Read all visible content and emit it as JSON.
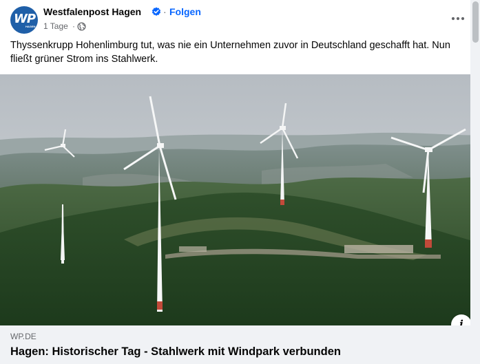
{
  "post": {
    "page_name": "Westfalenpost Hagen",
    "separator": "·",
    "follow_label": "Folgen",
    "time": "1 Tage",
    "meta_separator": "·",
    "text": "Thyssenkrupp Hohenlimburg tut, was nie ein Unternehmen zuvor in Deutschland geschafft hat. Nun fließt grüner Strom ins Stahlwerk.",
    "avatar_logo": "WP",
    "avatar_logo_sub": "HAGEN"
  },
  "link_card": {
    "domain": "WP.DE",
    "title": "Hagen: Historischer Tag - Stahlwerk mit Windpark verbunden"
  },
  "icons": {
    "verified": "verified-badge-icon",
    "privacy": "globe-icon",
    "more": "more-horizontal-icon",
    "info": "info-icon"
  },
  "colors": {
    "accent": "#0866ff",
    "secondary_text": "#65676b",
    "card_background": "#f0f2f5"
  }
}
